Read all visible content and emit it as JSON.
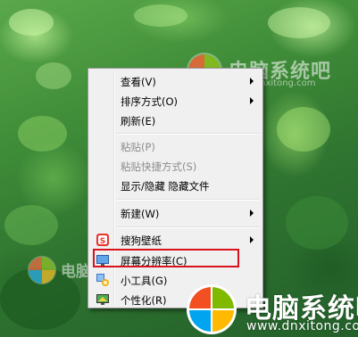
{
  "menu": {
    "items": [
      {
        "label": "查看(V)",
        "submenu": true,
        "disabled": false
      },
      {
        "label": "排序方式(O)",
        "submenu": true,
        "disabled": false
      },
      {
        "label": "刷新(E)",
        "submenu": false,
        "disabled": false
      },
      {
        "label": "粘贴(P)",
        "submenu": false,
        "disabled": true
      },
      {
        "label": "粘贴快捷方式(S)",
        "submenu": false,
        "disabled": true
      },
      {
        "label": "显示/隐藏 隐藏文件",
        "submenu": false,
        "disabled": false
      },
      {
        "label": "新建(W)",
        "submenu": true,
        "disabled": false
      },
      {
        "label": "搜狗壁纸",
        "submenu": true,
        "disabled": false,
        "icon": "sogou-wallpaper-icon"
      },
      {
        "label": "屏幕分辨率(C)",
        "submenu": false,
        "disabled": false,
        "icon": "screen-resolution-icon",
        "highlighted": true
      },
      {
        "label": "小工具(G)",
        "submenu": false,
        "disabled": false,
        "icon": "gadgets-icon"
      },
      {
        "label": "个性化(R)",
        "submenu": false,
        "disabled": false,
        "icon": "personalize-icon"
      }
    ]
  },
  "watermark": {
    "brand": "电脑系统吧",
    "url": "www.dnxitong.com",
    "colors": {
      "red": "#f25022",
      "green": "#7fba00",
      "blue": "#00a4ef",
      "yellow": "#ffb900"
    }
  },
  "highlight_color": "#d8131c"
}
